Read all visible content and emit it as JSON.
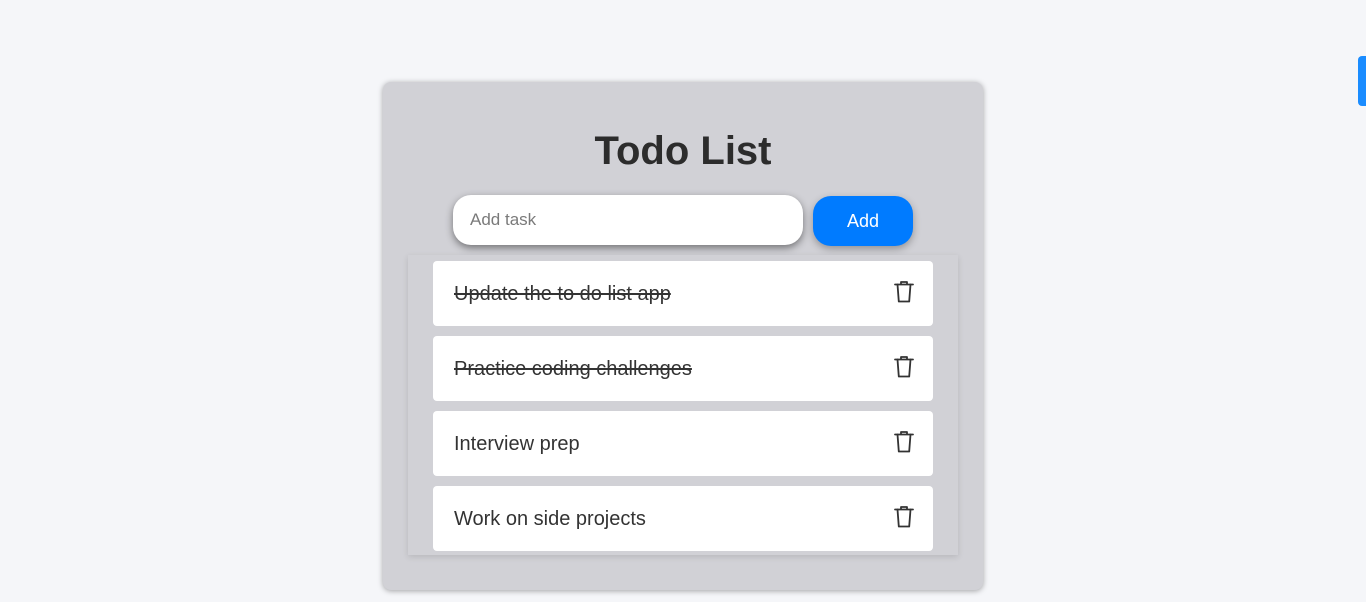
{
  "app": {
    "title": "Todo List"
  },
  "input": {
    "placeholder": "Add task",
    "value": ""
  },
  "add_button": {
    "label": "Add"
  },
  "tasks": [
    {
      "text": "Update the to do list app",
      "completed": true
    },
    {
      "text": "Practice coding challenges",
      "completed": true
    },
    {
      "text": "Interview prep",
      "completed": false
    },
    {
      "text": "Work on side projects",
      "completed": false
    }
  ],
  "icons": {
    "delete": "trash-icon"
  },
  "colors": {
    "accent": "#007bff",
    "card_background": "#d1d1d6",
    "page_background": "#f5f6f9",
    "edge_tab": "#1a8cff"
  }
}
